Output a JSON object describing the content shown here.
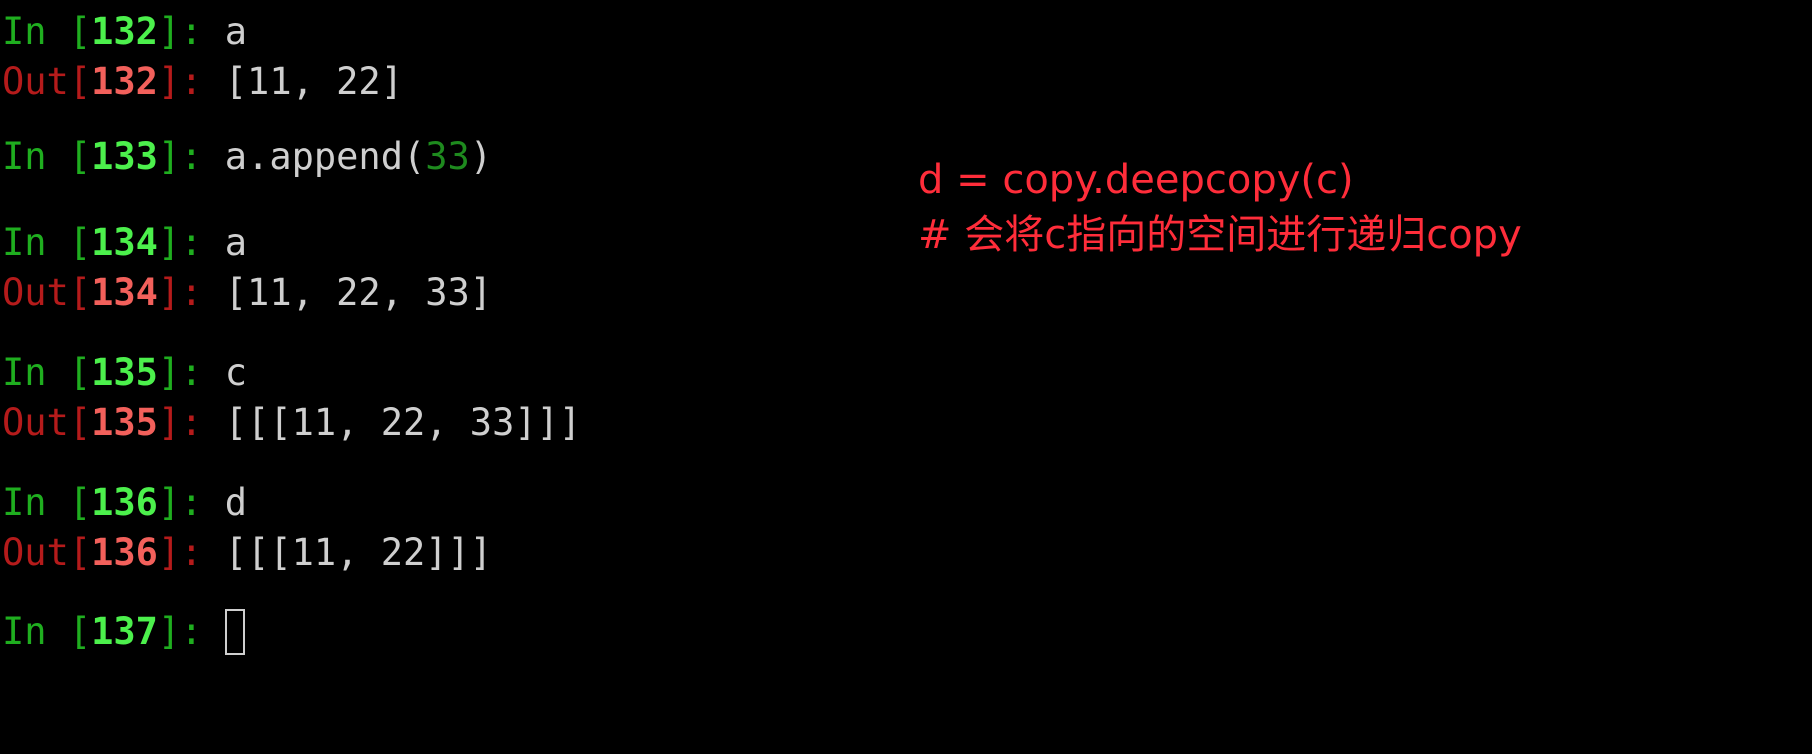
{
  "terminal": {
    "cells": [
      {
        "in_label": "In",
        "in_open": " [",
        "in_number": "132",
        "in_close": "]: ",
        "input": "a",
        "out_label": "Out",
        "out_open": "[",
        "out_number": "132",
        "out_close": "]: ",
        "output": "[11, 22]"
      },
      {
        "in_label": "In",
        "in_open": " [",
        "in_number": "133",
        "in_close": "]: ",
        "input_prefix": "a.append(",
        "input_number": "33",
        "input_suffix": ")"
      },
      {
        "in_label": "In",
        "in_open": " [",
        "in_number": "134",
        "in_close": "]: ",
        "input": "a",
        "out_label": "Out",
        "out_open": "[",
        "out_number": "134",
        "out_close": "]: ",
        "output": "[11, 22, 33]"
      },
      {
        "in_label": "In",
        "in_open": " [",
        "in_number": "135",
        "in_close": "]: ",
        "input": "c",
        "out_label": "Out",
        "out_open": "[",
        "out_number": "135",
        "out_close": "]: ",
        "output": "[[[11, 22, 33]]]"
      },
      {
        "in_label": "In",
        "in_open": " [",
        "in_number": "136",
        "in_close": "]: ",
        "input": "d",
        "out_label": "Out",
        "out_open": "[",
        "out_number": "136",
        "out_close": "]: ",
        "output": "[[[11, 22]]]"
      },
      {
        "in_label": "In",
        "in_open": " [",
        "in_number": "137",
        "in_close": "]: ",
        "input": ""
      }
    ]
  },
  "annotation": {
    "line1": "d = copy.deepcopy(c)",
    "line2": "# 会将c指向的空间进行递归copy",
    "color": "#ff2d3a"
  },
  "colors": {
    "background": "#000000",
    "text": "#cfcfcf",
    "in_prompt": "#1fae1f",
    "in_number": "#4cf04c",
    "out_prompt": "#b51b1b",
    "out_number": "#f2605b"
  }
}
